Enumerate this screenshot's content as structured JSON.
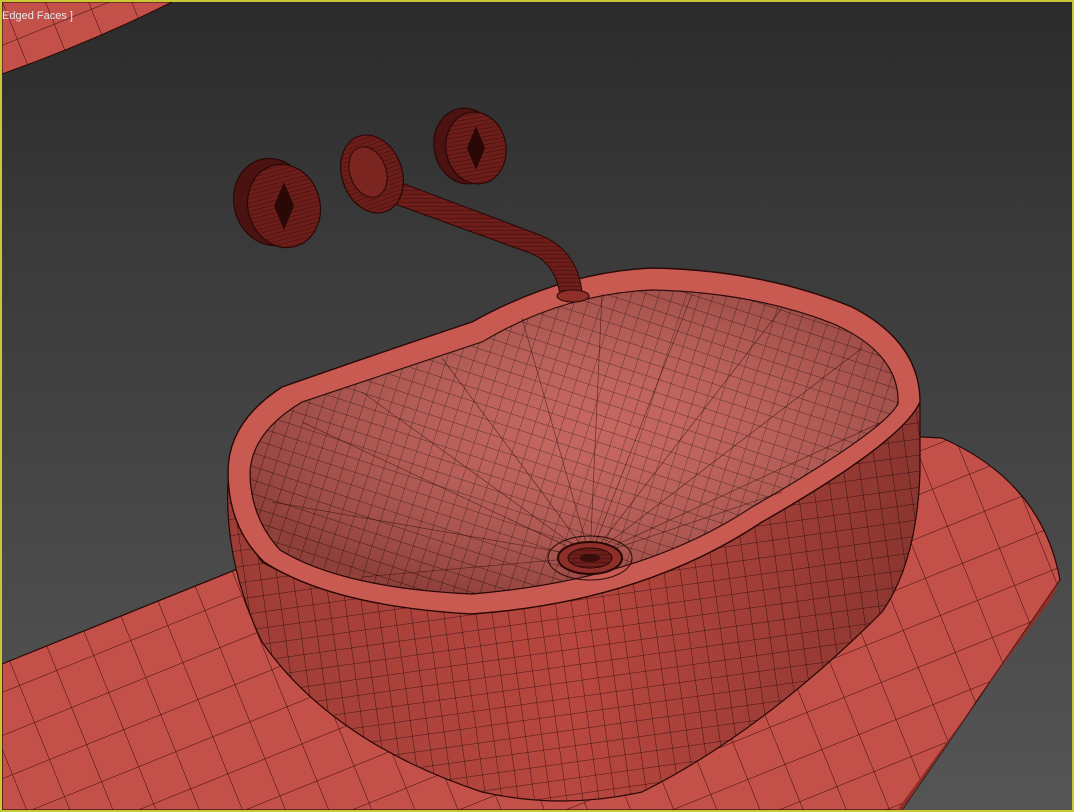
{
  "viewport": {
    "label": "Edged Faces ]",
    "active_border_color": "#c8c832",
    "background_color": "#3a3a3a"
  },
  "scene": {
    "mesh_color": "#c4504a",
    "wire_color": "#2a0a08",
    "objects": [
      "countertop",
      "basin",
      "spout",
      "left-handle",
      "right-handle",
      "flange",
      "drain"
    ]
  }
}
